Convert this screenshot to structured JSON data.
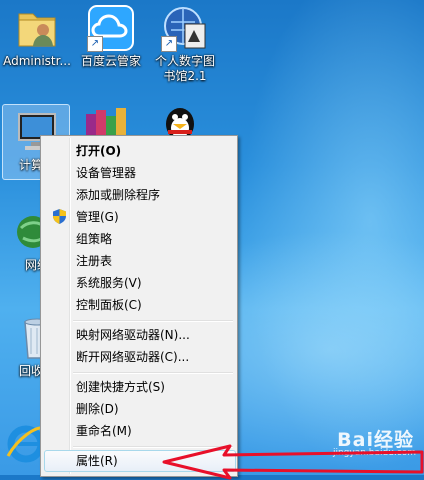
{
  "desktop": {
    "icons": [
      {
        "label": "Administr...",
        "icon": "user-folder-icon"
      },
      {
        "label": "百度云管家",
        "icon": "baidu-cloud-icon"
      },
      {
        "label": "个人数字图",
        "label2": "书馆2.1",
        "icon": "digital-library-icon"
      },
      {
        "label": "计算机",
        "icon": "computer-icon"
      },
      {
        "label": "网络",
        "icon": "network-icon"
      },
      {
        "label": "回收站",
        "icon": "recycle-bin-icon"
      }
    ]
  },
  "menu": {
    "items": [
      {
        "label": "打开(O)"
      },
      {
        "label": "设备管理器"
      },
      {
        "label": "添加或删除程序"
      },
      {
        "label": "管理(G)"
      },
      {
        "label": "组策略"
      },
      {
        "label": "注册表"
      },
      {
        "label": "系统服务(V)"
      },
      {
        "label": "控制面板(C)"
      },
      {
        "label": "映射网络驱动器(N)..."
      },
      {
        "label": "断开网络驱动器(C)..."
      },
      {
        "label": "创建快捷方式(S)"
      },
      {
        "label": "删除(D)"
      },
      {
        "label": "重命名(M)"
      },
      {
        "label": "属性(R)"
      }
    ]
  },
  "watermark": {
    "brand": "Bai经验",
    "url": "jingyan.baidu.com"
  },
  "colors": {
    "annotation_arrow": "#e8102a",
    "menu_bg": "#f1f1f1",
    "hover_border": "#a8d8eb"
  }
}
